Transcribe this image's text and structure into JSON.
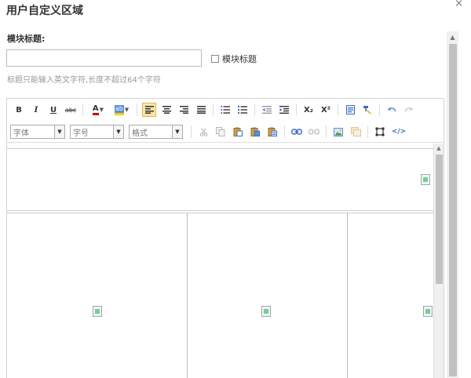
{
  "dialog": {
    "title": "用户自定义区域",
    "close": "×"
  },
  "form": {
    "label": "模块标题:",
    "input_value": "",
    "checkbox_label": "模块标题",
    "hint": "标题只能输入英文字符,长度不超过64个字符"
  },
  "toolbar": {
    "bold": "B",
    "italic": "I",
    "underline": "U",
    "strikethrough": "abc",
    "font_color": "A",
    "highlight": "ab",
    "subscript": "X₂",
    "superscript": "X²",
    "code": "</>",
    "font_family": "字体",
    "font_size": "字号",
    "format": "格式"
  },
  "colors": {
    "font_color_bar": "#d00000",
    "highlight_bar": "#f5d000",
    "active_bg": "#fbe4a8"
  }
}
